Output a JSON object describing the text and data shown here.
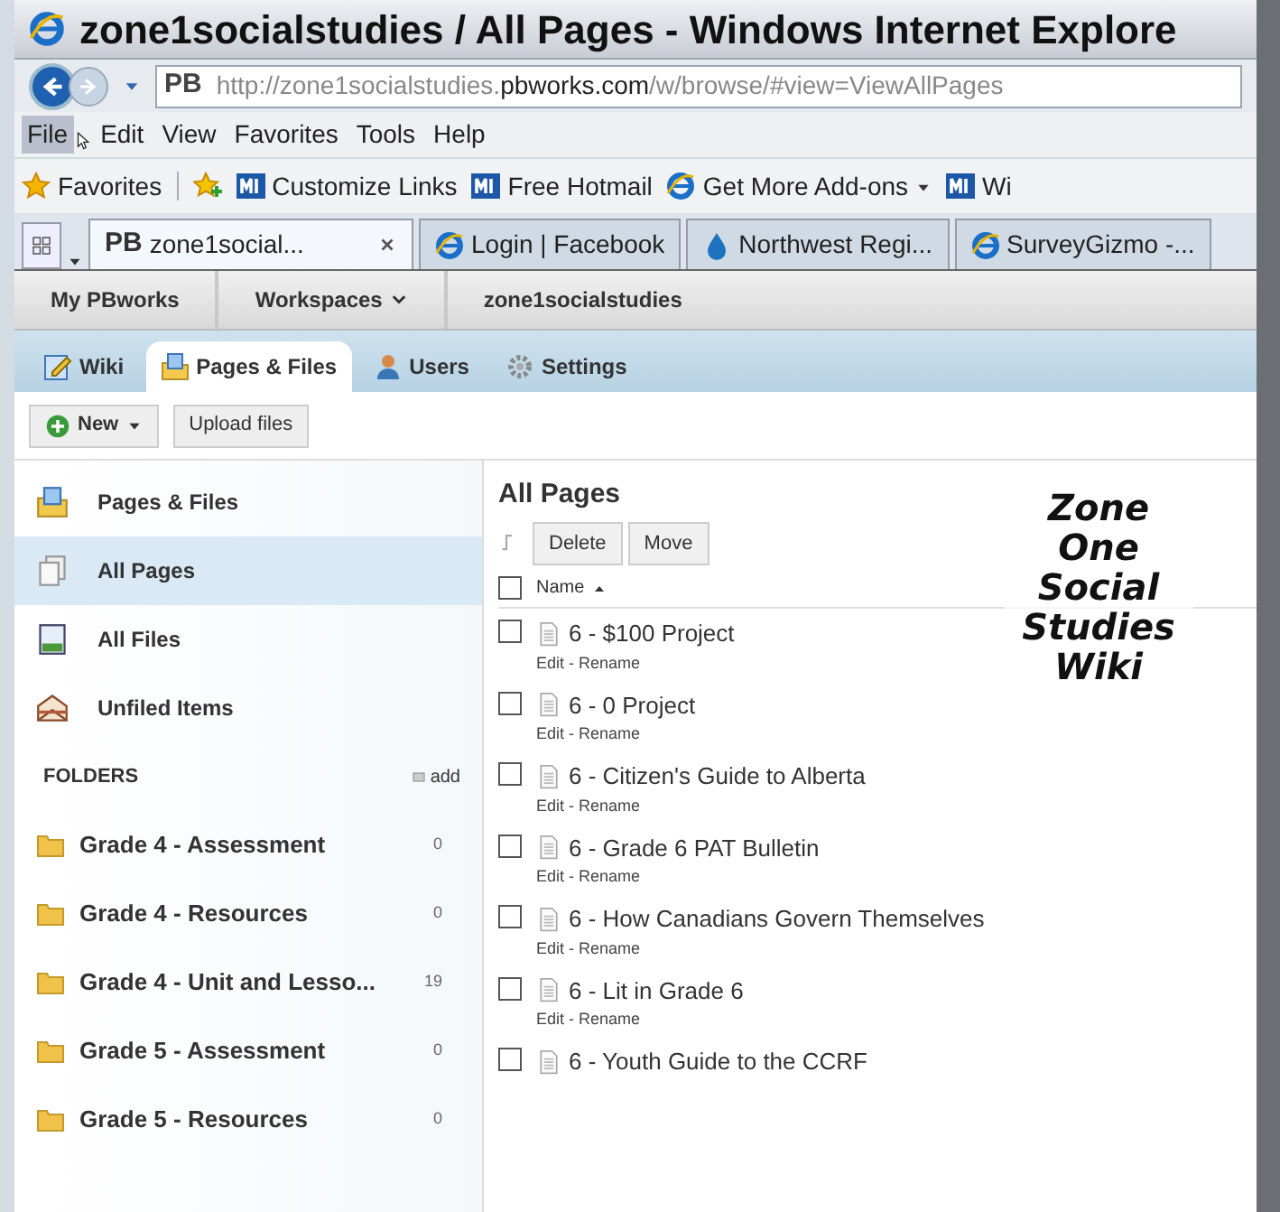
{
  "window": {
    "title": "zone1socialstudies / All Pages - Windows Internet Explore"
  },
  "address_bar": {
    "badge": "PB",
    "url_start": "http://zone1socialstudies.",
    "url_domain": "pbworks.com",
    "url_path": "/w/browse/#view=ViewAllPages"
  },
  "menu": [
    {
      "label": "File",
      "selected": true
    },
    {
      "label": "Edit",
      "selected": false
    },
    {
      "label": "View",
      "selected": false
    },
    {
      "label": "Favorites",
      "selected": false
    },
    {
      "label": "Tools",
      "selected": false
    },
    {
      "label": "Help",
      "selected": false
    }
  ],
  "favorites_bar": [
    {
      "kind": "star",
      "label": "Favorites"
    },
    {
      "kind": "addstar"
    },
    {
      "kind": "m",
      "label": "Customize Links"
    },
    {
      "kind": "m",
      "label": "Free Hotmail"
    },
    {
      "kind": "ie",
      "label": "Get More Add-ons",
      "dropdown": true
    },
    {
      "kind": "m",
      "label": "Wi"
    }
  ],
  "tabs": [
    {
      "kind": "pb",
      "badge": "PB",
      "label": "zone1social...",
      "selected": true
    },
    {
      "kind": "ie",
      "label": "Login | Facebook",
      "selected": false
    },
    {
      "kind": "drop",
      "label": "Northwest Regi...",
      "selected": false
    },
    {
      "kind": "ie",
      "label": "SurveyGizmo -...",
      "selected": false
    }
  ],
  "breadcrumb": [
    {
      "label": "My PBworks",
      "dropdown": false
    },
    {
      "label": "Workspaces",
      "dropdown": true
    },
    {
      "label": "zone1socialstudies",
      "dropdown": false
    }
  ],
  "nav_tabs": [
    {
      "kind": "wiki",
      "label": "Wiki",
      "selected": false
    },
    {
      "kind": "pages",
      "label": "Pages & Files",
      "selected": true
    },
    {
      "kind": "users",
      "label": "Users",
      "selected": false
    },
    {
      "kind": "settings",
      "label": "Settings",
      "selected": false
    }
  ],
  "actions": {
    "new_label": "New",
    "upload_label": "Upload files"
  },
  "sidebar": {
    "items": [
      {
        "kind": "pages",
        "label": "Pages & Files",
        "selected": false
      },
      {
        "kind": "allpages",
        "label": "All Pages",
        "selected": true
      },
      {
        "kind": "files",
        "label": "All Files",
        "selected": false
      },
      {
        "kind": "unfiled",
        "label": "Unfiled Items",
        "selected": false
      }
    ],
    "folders_heading": "FOLDERS",
    "add_label": "add",
    "folders": [
      {
        "name": "Grade 4 - Assessment",
        "count": "0"
      },
      {
        "name": "Grade 4 - Resources",
        "count": "0"
      },
      {
        "name": "Grade 4 - Unit and Lesso...",
        "count": "19"
      },
      {
        "name": "Grade 5 - Assessment",
        "count": "0"
      },
      {
        "name": "Grade 5 - Resources",
        "count": "0"
      }
    ]
  },
  "content": {
    "title": "All Pages",
    "buttons": [
      "Delete",
      "Move"
    ],
    "column": "Name",
    "sort_ascending": true,
    "select_all_checked": false,
    "rows": [
      {
        "name": "6 - $100 Project",
        "links": "Edit - Rename",
        "checked": false
      },
      {
        "name": "6 - 0 Project",
        "links": "Edit - Rename",
        "checked": false
      },
      {
        "name": "6 - Citizen's Guide to Alberta",
        "links": "Edit - Rename",
        "checked": false
      },
      {
        "name": "6 - Grade 6 PAT Bulletin",
        "links": "Edit - Rename",
        "checked": false
      },
      {
        "name": "6 - How Canadians Govern Themselves",
        "links": "Edit - Rename",
        "checked": false
      },
      {
        "name": "6 - Lit in Grade 6",
        "links": "Edit - Rename",
        "checked": false
      },
      {
        "name": "6 - Youth Guide to the CCRF",
        "checked": false
      }
    ]
  },
  "caption": [
    "Zone",
    "One",
    "Social",
    "Studies",
    "Wiki"
  ]
}
